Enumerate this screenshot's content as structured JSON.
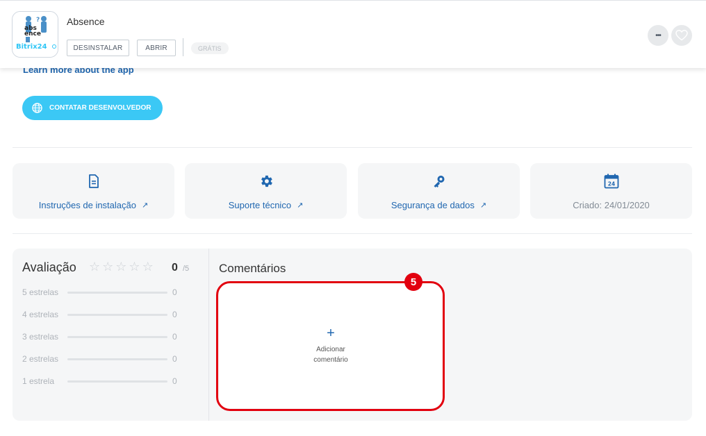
{
  "app": {
    "title": "Absence",
    "logo_text_top": "abs",
    "logo_text_mid": "ence",
    "logo_brand": "Bitrix24",
    "uninstall_label": "DESINSTALAR",
    "open_label": "ABRIR",
    "free_label": "GRÁTIS",
    "more_label": "•••"
  },
  "links": {
    "learn_more": "Learn more about the app",
    "contact_developer": "CONTATAR DESENVOLVEDOR"
  },
  "info_cards": [
    {
      "label": "Instruções de instalação",
      "icon": "document-icon",
      "arrow": "↗"
    },
    {
      "label": "Suporte técnico",
      "icon": "gear-icon",
      "arrow": "↗"
    },
    {
      "label": "Segurança de dados",
      "icon": "key-icon",
      "arrow": "↗"
    },
    {
      "label": "Criado: 24/01/2020",
      "icon": "calendar-icon",
      "calendar_day": "24"
    }
  ],
  "rating": {
    "title": "Avaliação",
    "score": "0",
    "max": "/5",
    "stars": 0,
    "rows": [
      {
        "label": "5 estrelas",
        "count": "0",
        "fraction": 0
      },
      {
        "label": "4 estrelas",
        "count": "0",
        "fraction": 0
      },
      {
        "label": "3 estrelas",
        "count": "0",
        "fraction": 0
      },
      {
        "label": "2 estrelas",
        "count": "0",
        "fraction": 0
      },
      {
        "label": "1 estrela",
        "count": "0",
        "fraction": 0
      }
    ]
  },
  "comments": {
    "title": "Comentários",
    "plus": "+",
    "add_label": "Adicionar comentário"
  },
  "annotation": {
    "step_number": "5",
    "color": "#e2000f"
  },
  "colors": {
    "accent_blue": "#2067b0",
    "contact_button": "#3bc8f5"
  }
}
